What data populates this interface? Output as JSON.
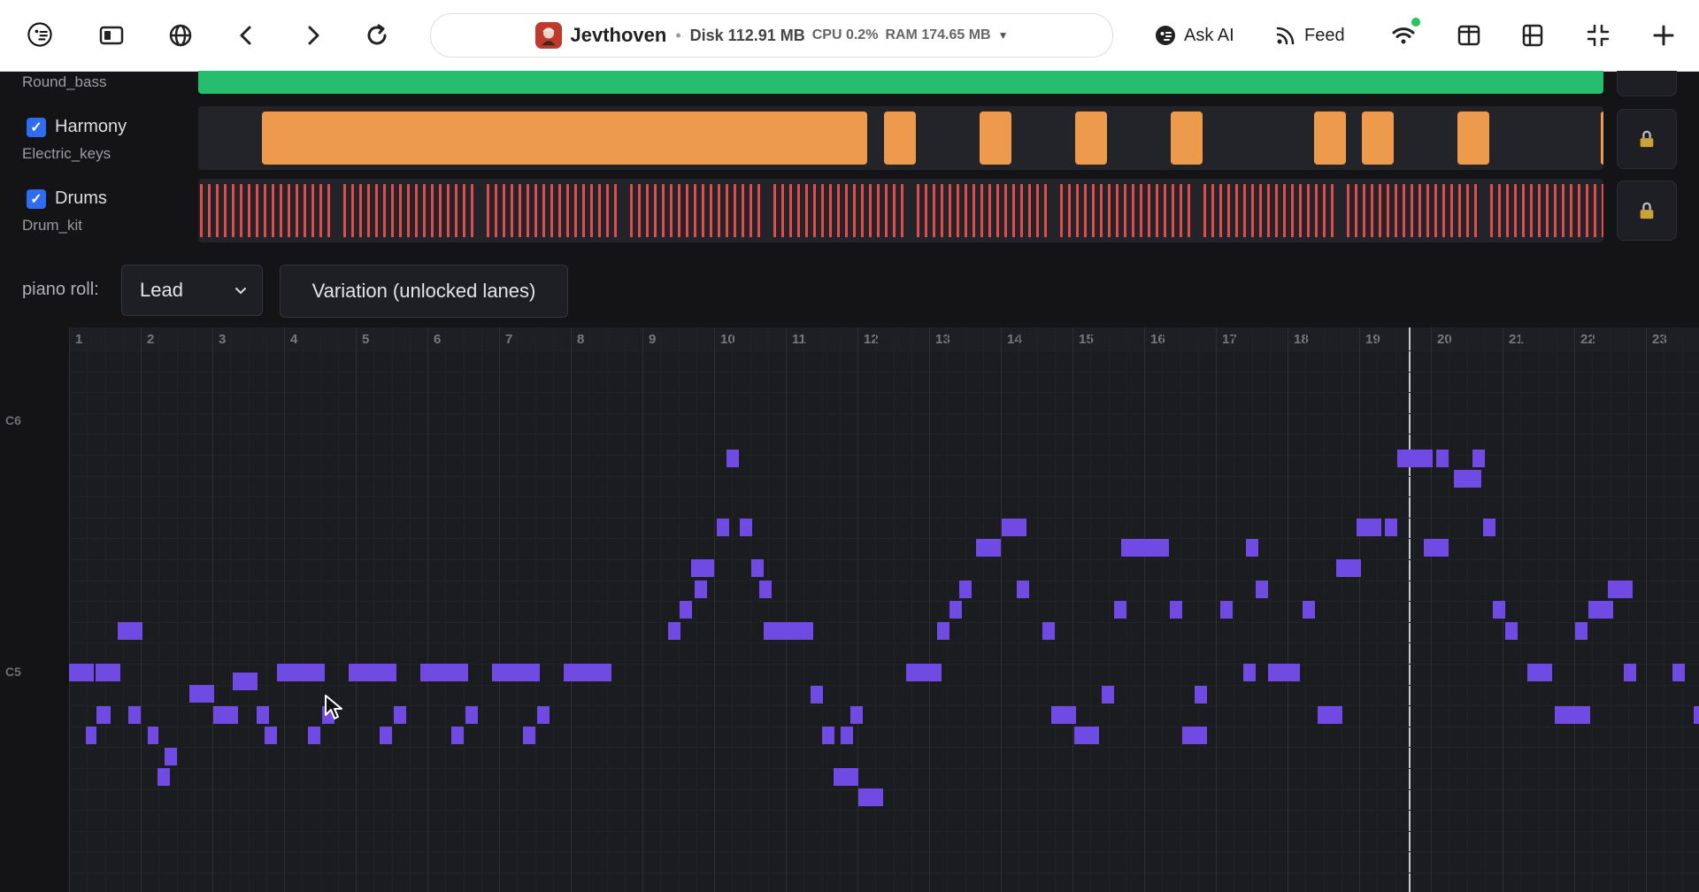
{
  "topbar": {
    "app_name": "Jevthoven",
    "disk": "Disk 112.91 MB",
    "cpu": "CPU 0.2%",
    "ram": "RAM 174.65 MB",
    "ask_ai": "Ask AI",
    "feed": "Feed"
  },
  "tracks": {
    "bass_sub": "Round_bass",
    "harmony": {
      "name": "Harmony",
      "instrument": "Electric_keys",
      "checked": true,
      "color": "#ee9a4d"
    },
    "drums": {
      "name": "Drums",
      "instrument": "Drum_kit",
      "checked": true,
      "color": "#e04b4b"
    },
    "bass_color": "#27bd6e"
  },
  "piano_roll": {
    "label": "piano roll:",
    "selected_track": "Lead",
    "variation_button": "Variation (unlocked lanes)",
    "key_labels": [
      "C6",
      "C5"
    ],
    "bars": [
      "1",
      "2",
      "3",
      "4",
      "5",
      "6",
      "7",
      "8",
      "9",
      "10",
      "11",
      "12",
      "13",
      "14",
      "15",
      "16",
      "17",
      "18",
      "19",
      "20",
      "21",
      "22",
      "23"
    ],
    "note_color": "#6f4be3"
  }
}
